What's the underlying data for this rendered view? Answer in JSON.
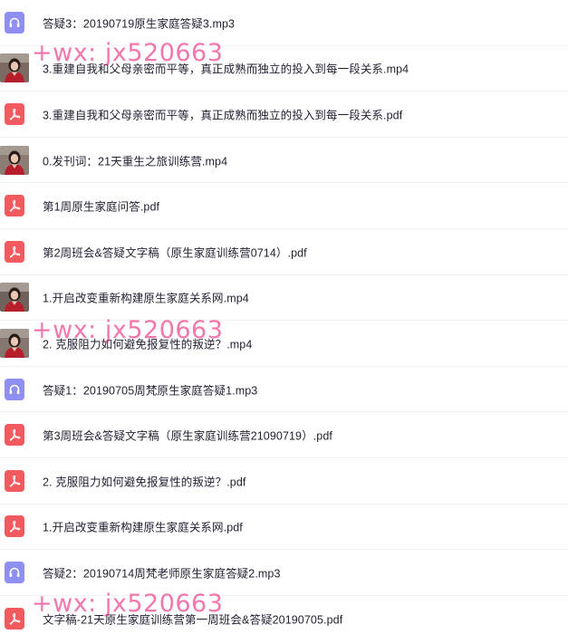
{
  "files": [
    {
      "name": "答疑3：20190719原生家庭答疑3.mp3",
      "type": "audio",
      "icon": "headphones-icon"
    },
    {
      "name": "3.重建自我和父母亲密而平等，真正成熟而独立的投入到每一段关系.mp4",
      "type": "video",
      "icon": "video-thumbnail"
    },
    {
      "name": "3.重建自我和父母亲密而平等，真正成熟而独立的投入到每一段关系.pdf",
      "type": "pdf",
      "icon": "pdf-icon"
    },
    {
      "name": "0.发刊词：21天重生之旅训练营.mp4",
      "type": "video",
      "icon": "video-thumbnail"
    },
    {
      "name": "第1周原生家庭问答.pdf",
      "type": "pdf",
      "icon": "pdf-icon"
    },
    {
      "name": "第2周班会&答疑文字稿（原生家庭训练营0714）.pdf",
      "type": "pdf",
      "icon": "pdf-icon"
    },
    {
      "name": "1.开启改变重新构建原生家庭关系网.mp4",
      "type": "video",
      "icon": "video-thumbnail"
    },
    {
      "name": "2. 克服阻力如何避免报复性的叛逆？.mp4",
      "type": "video",
      "icon": "video-thumbnail"
    },
    {
      "name": "答疑1：20190705周梵原生家庭答疑1.mp3",
      "type": "audio",
      "icon": "headphones-icon"
    },
    {
      "name": "第3周班会&答疑文字稿（原生家庭训练营21090719）.pdf",
      "type": "pdf",
      "icon": "pdf-icon"
    },
    {
      "name": "2. 克服阻力如何避免报复性的叛逆？.pdf",
      "type": "pdf",
      "icon": "pdf-icon"
    },
    {
      "name": "1.开启改变重新构建原生家庭关系网.pdf",
      "type": "pdf",
      "icon": "pdf-icon"
    },
    {
      "name": "答疑2：20190714周梵老师原生家庭答疑2.mp3",
      "type": "audio",
      "icon": "headphones-icon"
    },
    {
      "name": "文字稿-21天原生家庭训练营第一周班会&答疑20190705.pdf",
      "type": "pdf",
      "icon": "pdf-icon"
    }
  ],
  "watermark": {
    "text": "+wx: jx520663",
    "color": "#ec247a"
  },
  "colors": {
    "audio_icon": "#8f8ff3",
    "pdf_icon": "#f25a60",
    "text": "#222233",
    "divider": "#f2f2f4"
  }
}
